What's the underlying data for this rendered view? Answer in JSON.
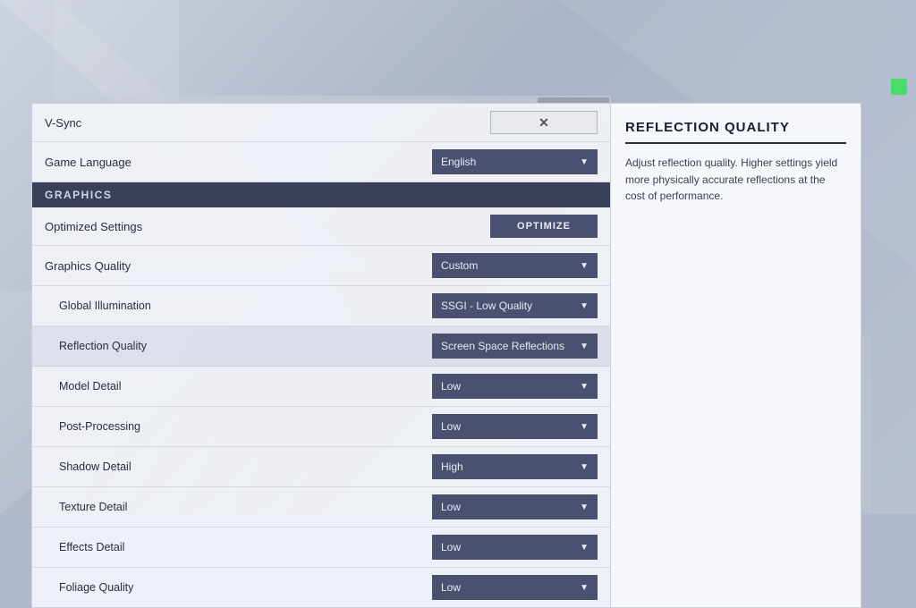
{
  "background": {
    "color": "#b0b8cc"
  },
  "status_indicator": {
    "color": "#4adb6a"
  },
  "settings": {
    "vsync": {
      "label": "V-Sync",
      "button_symbol": "✕"
    },
    "game_language": {
      "label": "Game Language",
      "value": "English"
    },
    "graphics_section": {
      "header": "GRAPHICS",
      "optimize": {
        "label": "Optimized Settings",
        "button_text": "OPTIMIZE"
      },
      "graphics_quality": {
        "label": "Graphics Quality",
        "value": "Custom"
      },
      "global_illumination": {
        "label": "Global Illumination",
        "value": "SSGI - Low Quality"
      },
      "reflection_quality": {
        "label": "Reflection Quality",
        "value": "Screen Space Reflections"
      },
      "model_detail": {
        "label": "Model Detail",
        "value": "Low"
      },
      "post_processing": {
        "label": "Post-Processing",
        "value": "Low"
      },
      "shadow_detail": {
        "label": "Shadow Detail",
        "value": "High"
      },
      "texture_detail": {
        "label": "Texture Detail",
        "value": "Low"
      },
      "effects_detail": {
        "label": "Effects Detail",
        "value": "Low"
      },
      "foliage_quality": {
        "label": "Foliage Quality",
        "value": "Low"
      }
    }
  },
  "info_panel": {
    "title": "REFLECTION QUALITY",
    "description": "Adjust reflection quality. Higher settings yield more physically accurate reflections at the cost of performance."
  }
}
